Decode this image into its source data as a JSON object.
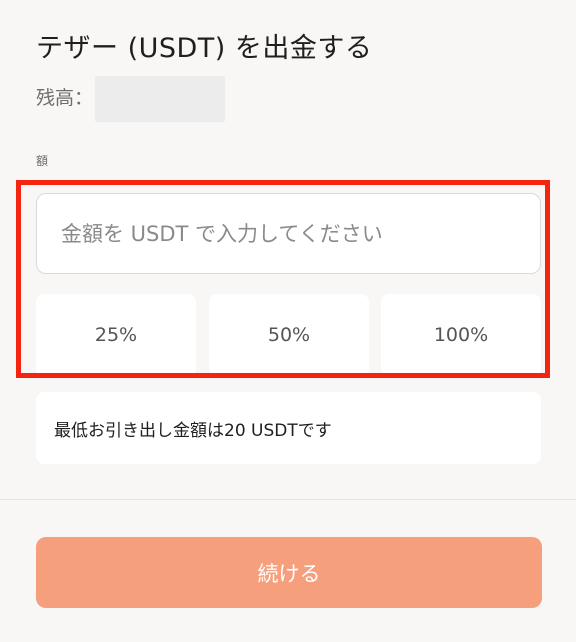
{
  "header": {
    "title": "テザー (USDT) を出金する",
    "balance_label": "残高：",
    "balance_value": ""
  },
  "amount": {
    "label": "額",
    "placeholder": "金額を USDT で入力してください",
    "value": ""
  },
  "percent_buttons": [
    {
      "label": "25%"
    },
    {
      "label": "50%"
    },
    {
      "label": "100%"
    }
  ],
  "info": {
    "min_withdrawal_text": "最低お引き出し金額は20 USDTです"
  },
  "footer": {
    "continue_label": "続ける"
  },
  "colors": {
    "background": "#f8f7f5",
    "highlight_frame": "#f42410",
    "continue_button": "#f59f7d",
    "balance_placeholder": "#ececec"
  }
}
